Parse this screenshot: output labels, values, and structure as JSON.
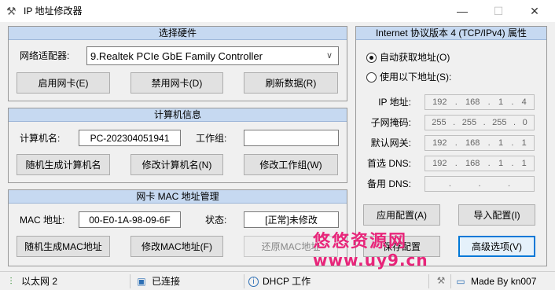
{
  "window": {
    "title": "IP 地址修改器",
    "app_icon": "tools-icon",
    "minimize": "—",
    "maximize": "☐",
    "close": "✕"
  },
  "hardware": {
    "header": "选择硬件",
    "adapter_label": "网络适配器:",
    "adapter_value": "9.Realtek PCIe GbE Family Controller",
    "enable_btn": "启用网卡(E)",
    "disable_btn": "禁用网卡(D)",
    "refresh_btn": "刷新数据(R)"
  },
  "computer": {
    "header": "计算机信息",
    "name_label": "计算机名:",
    "name_value": "PC-202304051941",
    "workgroup_label": "工作组:",
    "workgroup_value": "",
    "random_name_btn": "随机生成计算机名",
    "modify_name_btn": "修改计算机名(N)",
    "modify_workgroup_btn": "修改工作组(W)"
  },
  "mac": {
    "header": "网卡 MAC 地址管理",
    "mac_label": "MAC 地址:",
    "mac_value": "00-E0-1A-98-09-6F",
    "status_label": "状态:",
    "status_value": "[正常]未修改",
    "random_mac_btn": "随机生成MAC地址",
    "modify_mac_btn": "修改MAC地址(F)",
    "restore_mac_btn": "还原MAC地址"
  },
  "ipv4": {
    "header": "Internet 协议版本 4 (TCP/IPv4) 属性",
    "auto_option": "自动获取地址(O)",
    "manual_option": "使用以下地址(S):",
    "auto_selected": true,
    "fields": [
      {
        "label": "IP 地址:",
        "octets": [
          "192",
          "168",
          "1",
          "4"
        ]
      },
      {
        "label": "子网掩码:",
        "octets": [
          "255",
          "255",
          "255",
          "0"
        ]
      },
      {
        "label": "默认网关:",
        "octets": [
          "192",
          "168",
          "1",
          "1"
        ]
      },
      {
        "label": "首选 DNS:",
        "octets": [
          "192",
          "168",
          "1",
          "1"
        ]
      },
      {
        "label": "备用 DNS:",
        "octets": [
          "",
          "",
          "",
          ""
        ]
      }
    ],
    "apply_btn": "应用配置(A)",
    "import_btn": "导入配置(I)",
    "hidden_btn": "保存配置",
    "advanced_btn": "高级选项(V)"
  },
  "watermark": {
    "line1": "悠悠资源网",
    "line2": "www.uy9.cn",
    "color": "#e8257a"
  },
  "statusbar": {
    "network": "以太网 2",
    "connection": "已连接",
    "dhcp": "DHCP 工作",
    "author": "Made By kn007",
    "icons": [
      "network-icon",
      "connected-icon",
      "info-icon",
      "tools-icon",
      "window-icon"
    ]
  }
}
